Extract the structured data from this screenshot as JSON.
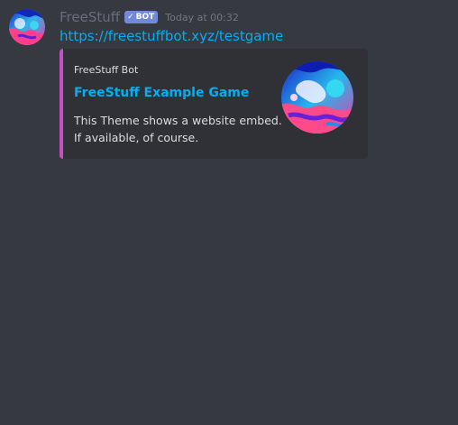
{
  "message": {
    "username": "FreeStuff",
    "bot_tag": "BOT",
    "bot_check": "✓",
    "timestamp": "Today at 00:32",
    "link": "https://freestuffbot.xyz/testgame"
  },
  "embed": {
    "author": "FreeStuff Bot",
    "title": "FreeStuff Example Game",
    "description_lines": [
      "This Theme shows a website embed.",
      "If available, of course."
    ],
    "accent_color": "#c251c4"
  },
  "colors": {
    "background": "#36393f",
    "embed_background": "#2f3136",
    "link": "#00aff4",
    "bot_tag": "#7289da",
    "username": "#6a6e76"
  }
}
